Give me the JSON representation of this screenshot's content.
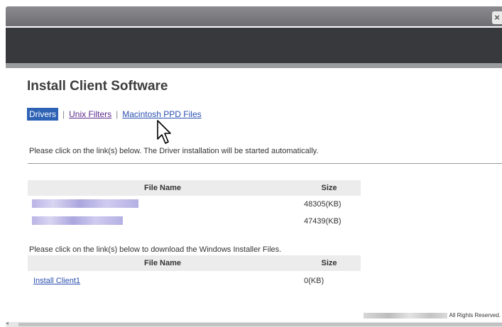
{
  "window": {
    "close_label": "×"
  },
  "page": {
    "title": "Install Client Software"
  },
  "tabs": [
    {
      "label": "Drivers",
      "active": true
    },
    {
      "label": "Unix Filters",
      "active": false
    },
    {
      "label": "Macintosh PPD Files",
      "active": false
    }
  ],
  "tab_separator": "|",
  "driver_section": {
    "instruction": "Please click on the link(s) below. The Driver installation will be started automatically.",
    "columns": {
      "name": "File Name",
      "size": "Size"
    },
    "rows": [
      {
        "size": "48305(KB)"
      },
      {
        "size": "47439(KB)"
      }
    ]
  },
  "installer_section": {
    "instruction": "Please click on the link(s) below to download the Windows Installer Files.",
    "columns": {
      "name": "File Name",
      "size": "Size"
    },
    "rows": [
      {
        "name": "Install Client1",
        "size": "0(KB)"
      }
    ]
  },
  "footer": {
    "text": "All Rights Reserved."
  },
  "colors": {
    "accent": "#2d62b5",
    "link": "#2a4fb0",
    "header_dark": "#38393c"
  }
}
